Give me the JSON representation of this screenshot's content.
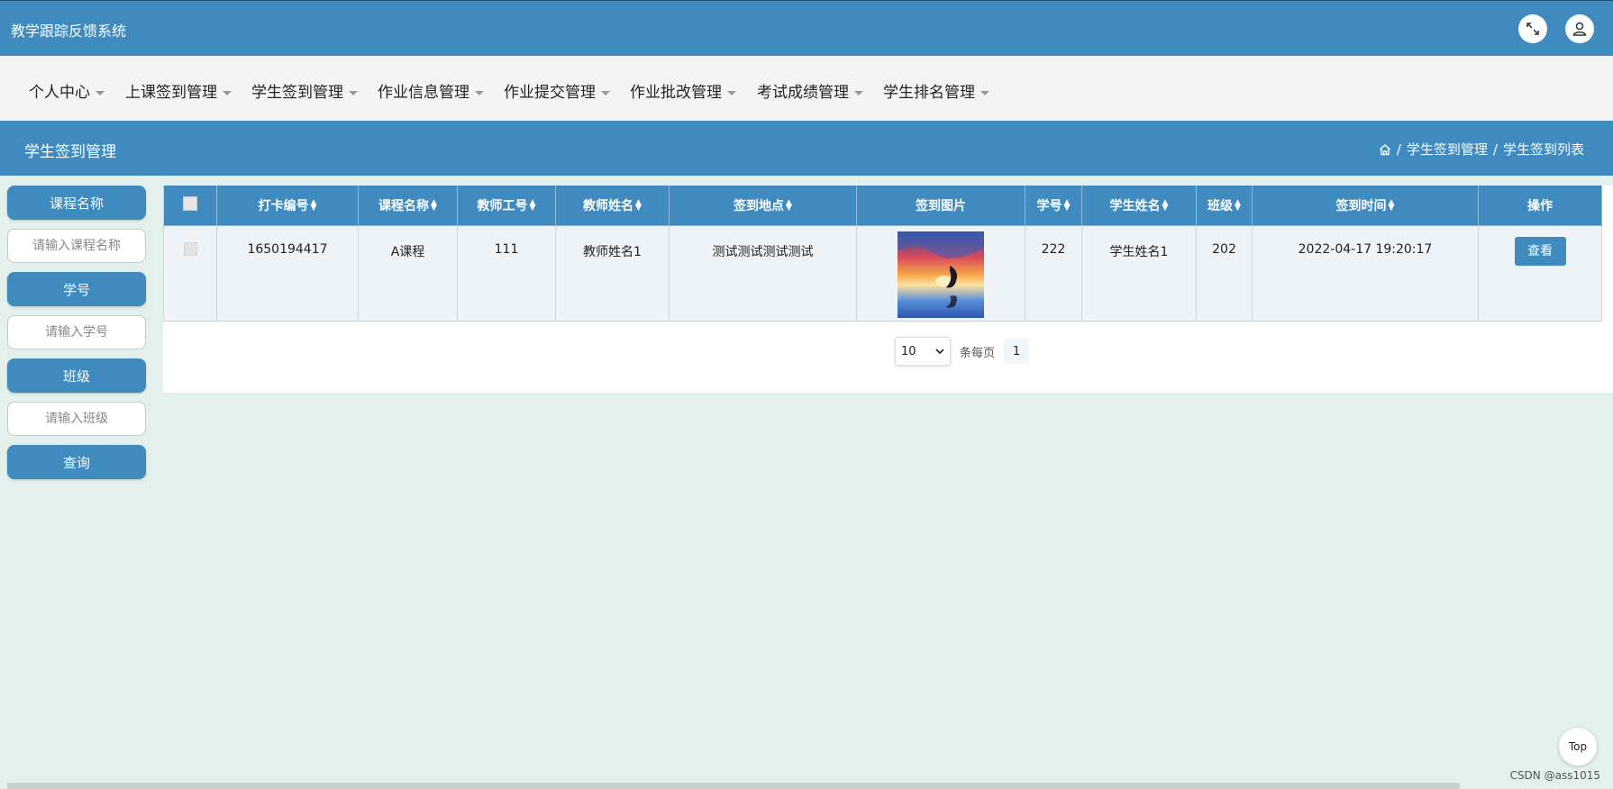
{
  "app_title": "教学跟踪反馈系统",
  "menu": [
    {
      "label": "个人中心"
    },
    {
      "label": "上课签到管理"
    },
    {
      "label": "学生签到管理"
    },
    {
      "label": "作业信息管理"
    },
    {
      "label": "作业提交管理"
    },
    {
      "label": "作业批改管理"
    },
    {
      "label": "考试成绩管理"
    },
    {
      "label": "学生排名管理"
    }
  ],
  "page": {
    "title": "学生签到管理",
    "breadcrumb": [
      "学生签到管理",
      "学生签到列表"
    ]
  },
  "filters": {
    "course_label": "课程名称",
    "course_placeholder": "请输入课程名称",
    "student_no_label": "学号",
    "student_no_placeholder": "请输入学号",
    "class_label": "班级",
    "class_placeholder": "请输入班级",
    "query_label": "查询"
  },
  "table": {
    "columns": [
      "打卡编号",
      "课程名称",
      "教师工号",
      "教师姓名",
      "签到地点",
      "签到图片",
      "学号",
      "学生姓名",
      "班级",
      "签到时间",
      "操作"
    ],
    "rows": [
      {
        "punch_no": "1650194417",
        "course": "A课程",
        "teacher_no": "111",
        "teacher_name": "教师姓名1",
        "location": "测试测试测试测试",
        "student_no": "222",
        "student_name": "学生姓名1",
        "class": "202",
        "time": "2022-04-17 19:20:17",
        "action": "查看"
      }
    ]
  },
  "pagination": {
    "page_size": "10",
    "per_page_label": "条每页",
    "current_page": "1"
  },
  "back_to_top": "Top",
  "watermark": "CSDN @ass1015",
  "colors": {
    "primary": "#3f8bbf",
    "background": "#e3f0ec",
    "menu_background": "#f4f4f4"
  }
}
